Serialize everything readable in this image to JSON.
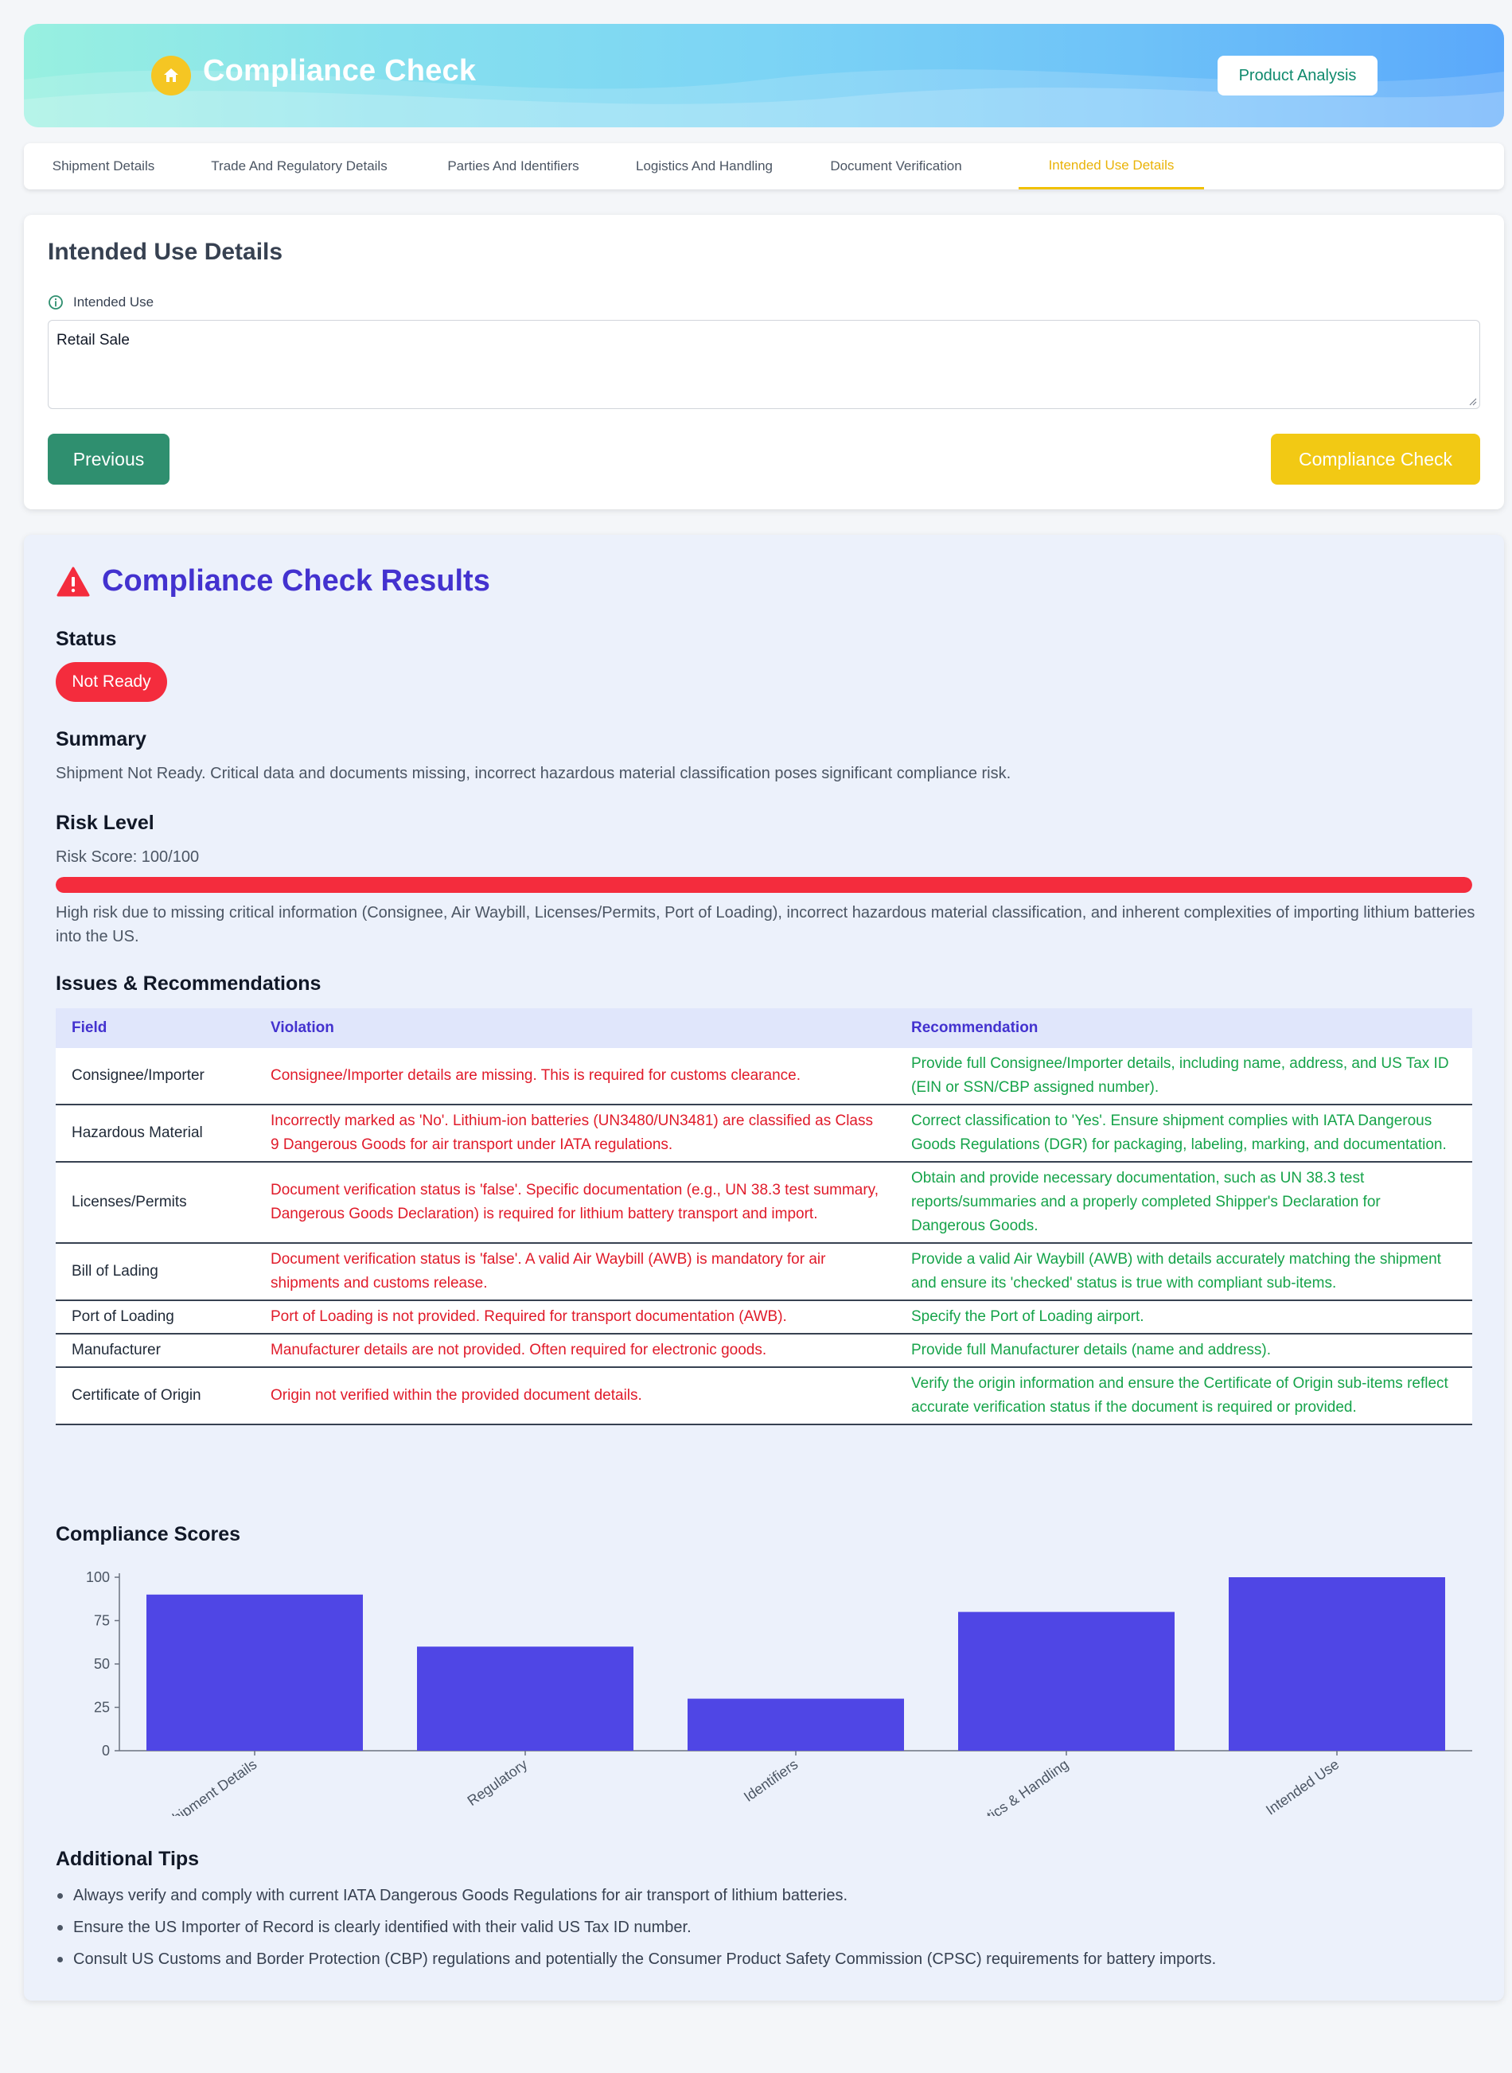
{
  "header": {
    "title": "Compliance Check",
    "icon": "home-icon",
    "product_analysis_label": "Product Analysis"
  },
  "tabs": [
    {
      "label": "Shipment Details",
      "active": false
    },
    {
      "label": "Trade And Regulatory Details",
      "active": false
    },
    {
      "label": "Parties And Identifiers",
      "active": false
    },
    {
      "label": "Logistics And Handling",
      "active": false
    },
    {
      "label": "Document Verification",
      "active": false
    },
    {
      "label": "Intended Use Details",
      "active": true
    }
  ],
  "form": {
    "title": "Intended Use Details",
    "field_label": "Intended Use",
    "field_value": "Retail Sale",
    "previous_label": "Previous",
    "check_label": "Compliance Check"
  },
  "results": {
    "title": "Compliance Check Results",
    "status_heading": "Status",
    "status_value": "Not Ready",
    "summary_heading": "Summary",
    "summary_text": "Shipment Not Ready. Critical data and documents missing, incorrect hazardous material classification poses significant compliance risk.",
    "risk_heading": "Risk Level",
    "risk_score_text": "Risk Score: 100/100",
    "risk_score_value": 100,
    "risk_score_max": 100,
    "risk_description": "High risk due to missing critical information (Consignee, Air Waybill, Licenses/Permits, Port of Loading), incorrect hazardous material classification, and inherent complexities of importing lithium batteries into the US.",
    "issues_heading": "Issues & Recommendations",
    "columns": [
      "Field",
      "Violation",
      "Recommendation"
    ],
    "issues": [
      {
        "field": "Consignee/Importer",
        "violation": "Consignee/Importer details are missing. This is required for customs clearance.",
        "recommendation": "Provide full Consignee/Importer details, including name, address, and US Tax ID (EIN or SSN/CBP assigned number)."
      },
      {
        "field": "Hazardous Material",
        "violation": "Incorrectly marked as 'No'. Lithium-ion batteries (UN3480/UN3481) are classified as Class 9 Dangerous Goods for air transport under IATA regulations.",
        "recommendation": "Correct classification to 'Yes'. Ensure shipment complies with IATA Dangerous Goods Regulations (DGR) for packaging, labeling, marking, and documentation."
      },
      {
        "field": "Licenses/Permits",
        "violation": "Document verification status is 'false'. Specific documentation (e.g., UN 38.3 test summary, Dangerous Goods Declaration) is required for lithium battery transport and import.",
        "recommendation": "Obtain and provide necessary documentation, such as UN 38.3 test reports/summaries and a properly completed Shipper's Declaration for Dangerous Goods."
      },
      {
        "field": "Bill of Lading",
        "violation": "Document verification status is 'false'. A valid Air Waybill (AWB) is mandatory for air shipments and customs release.",
        "recommendation": "Provide a valid Air Waybill (AWB) with details accurately matching the shipment and ensure its 'checked' status is true with compliant sub-items."
      },
      {
        "field": "Port of Loading",
        "violation": "Port of Loading is not provided. Required for transport documentation (AWB).",
        "recommendation": "Specify the Port of Loading airport."
      },
      {
        "field": "Manufacturer",
        "violation": "Manufacturer details are not provided. Often required for electronic goods.",
        "recommendation": "Provide full Manufacturer details (name and address)."
      },
      {
        "field": "Certificate of Origin",
        "violation": "Origin not verified within the provided document details.",
        "recommendation": "Verify the origin information and ensure the Certificate of Origin sub-items reflect accurate verification status if the document is required or provided."
      }
    ],
    "scores_heading": "Compliance Scores",
    "tips_heading": "Additional Tips",
    "tips": [
      "Always verify and comply with current IATA Dangerous Goods Regulations for air transport of lithium batteries.",
      "Ensure the US Importer of Record is clearly identified with their valid US Tax ID number.",
      "Consult US Customs and Border Protection (CBP) regulations and potentially the Consumer Product Safety Commission (CPSC) requirements for battery imports."
    ]
  },
  "colors": {
    "accent_green": "#2f8f6f",
    "accent_yellow": "#f2c914",
    "danger_red": "#f42c3d",
    "results_title": "#4332cf",
    "bar_color": "#4f46e5"
  },
  "chart_data": {
    "type": "bar",
    "categories": [
      "Shipment Details",
      "Regulatory",
      "Identifiers",
      "Logistics & Handling",
      "Intended Use"
    ],
    "values": [
      90,
      60,
      30,
      80,
      100
    ],
    "ylim": [
      0,
      100
    ],
    "yticks": [
      0,
      25,
      50,
      75,
      100
    ],
    "grid": false
  }
}
